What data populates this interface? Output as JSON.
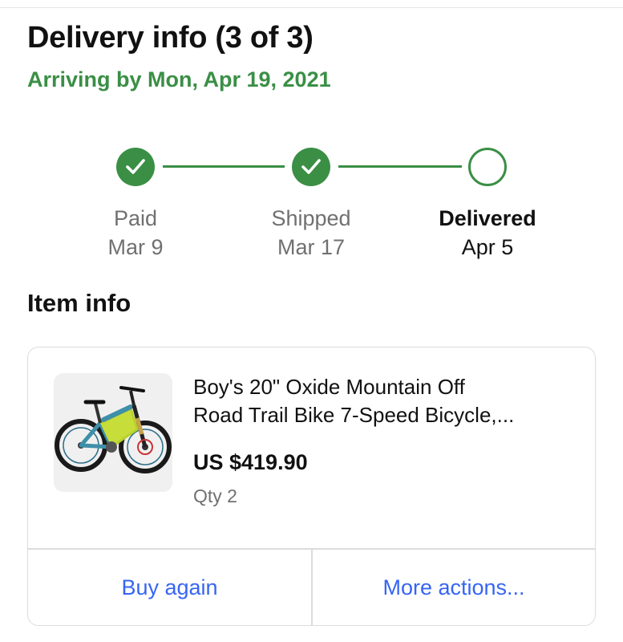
{
  "header": {
    "title": "Delivery info (3 of 3)",
    "arrival": "Arriving by Mon, Apr 19, 2021"
  },
  "colors": {
    "accent_green": "#3a8f45",
    "link_blue": "#3665f3",
    "muted_text": "#707070"
  },
  "progress": {
    "steps": [
      {
        "name": "Paid",
        "date": "Mar 9",
        "status": "complete",
        "icon": "check-icon"
      },
      {
        "name": "Shipped",
        "date": "Mar 17",
        "status": "complete",
        "icon": "check-icon"
      },
      {
        "name": "Delivered",
        "date": "Apr 5",
        "status": "current",
        "icon": "empty-circle-icon"
      }
    ]
  },
  "item_info": {
    "section_title": "Item info",
    "item": {
      "title_line1": "Boy's 20\" Oxide Mountain Off",
      "title_line2": "Road Trail Bike 7-Speed Bicycle,...",
      "price": "US $419.90",
      "qty": "Qty 2",
      "image": "mountain-bike-image"
    },
    "actions": {
      "buy_again": "Buy again",
      "more_actions": "More actions..."
    }
  }
}
